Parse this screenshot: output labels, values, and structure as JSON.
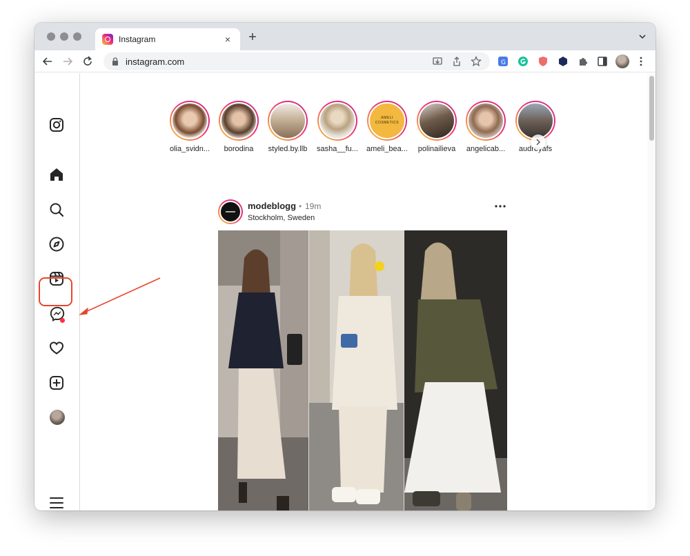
{
  "browser": {
    "tab_title": "Instagram",
    "tab_close": "×",
    "new_tab": "+",
    "url": "instagram.com"
  },
  "sidebar": {
    "items": [
      {
        "name": "instagram-logo-icon"
      },
      {
        "name": "home-icon"
      },
      {
        "name": "search-icon"
      },
      {
        "name": "explore-icon"
      },
      {
        "name": "reels-icon"
      },
      {
        "name": "messenger-icon"
      },
      {
        "name": "notifications-heart-icon"
      },
      {
        "name": "create-plus-icon"
      },
      {
        "name": "profile-avatar"
      },
      {
        "name": "more-menu-icon"
      }
    ]
  },
  "stories": [
    {
      "username": "olia_svidn..."
    },
    {
      "username": "borodina"
    },
    {
      "username": "styled.by.llb"
    },
    {
      "username": "sasha__fu..."
    },
    {
      "username": "ameli_bea...",
      "avatar_text_1": "AMELI",
      "avatar_text_2": "COSMETICS"
    },
    {
      "username": "polinailieva"
    },
    {
      "username": "angelicab..."
    },
    {
      "username": "audreyafs"
    }
  ],
  "post": {
    "username": "modeblogg",
    "separator": "•",
    "time": "19m",
    "location": "Stockholm, Sweden"
  },
  "colors": {
    "highlight_border": "#e8452c",
    "story_ring_start": "#f9ce34",
    "story_ring_end": "#c13584",
    "notification_dot": "#ff3040"
  }
}
